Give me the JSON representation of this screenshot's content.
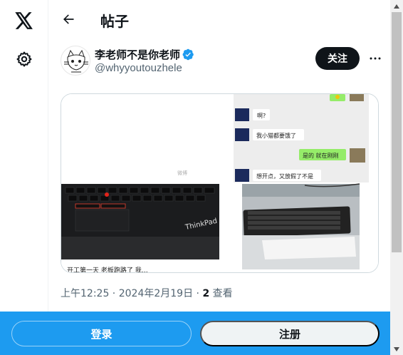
{
  "rail": {
    "logo_icon": "x-logo-icon",
    "settings_icon": "gear-icon"
  },
  "header": {
    "back_icon": "arrow-left-icon",
    "title": "帖子"
  },
  "author": {
    "name": "李老师不是你老师",
    "handle": "@whyyoutouzhele",
    "verified_icon": "verified-badge-icon",
    "follow_label": "关注",
    "more_icon": "more-horizontal-icon"
  },
  "media": {
    "image_a": {
      "caption": "开工第一天 老板跑路了 我…",
      "watermark": "微博"
    },
    "image_b": {
      "chat": [
        {
          "side": "left",
          "text": "啊?"
        },
        {
          "side": "left",
          "text": "我小猫都要饿了"
        },
        {
          "side": "right",
          "text": "是的 就在刚刚"
        },
        {
          "side": "left",
          "text": "想开点，又放假了不是"
        }
      ]
    }
  },
  "meta": {
    "time": "上午12:25",
    "sep1": " · ",
    "date": "2024年2月19日",
    "sep2": " · ",
    "views_count": "2",
    "views_label": " 查看"
  },
  "bottom": {
    "login_label": "登录",
    "signup_label": "注册"
  },
  "colors": {
    "accent": "#1d9bf0",
    "verified": "#1d9bf0",
    "text": "#0f1419",
    "muted": "#536471",
    "chat_green": "#95ec69"
  }
}
